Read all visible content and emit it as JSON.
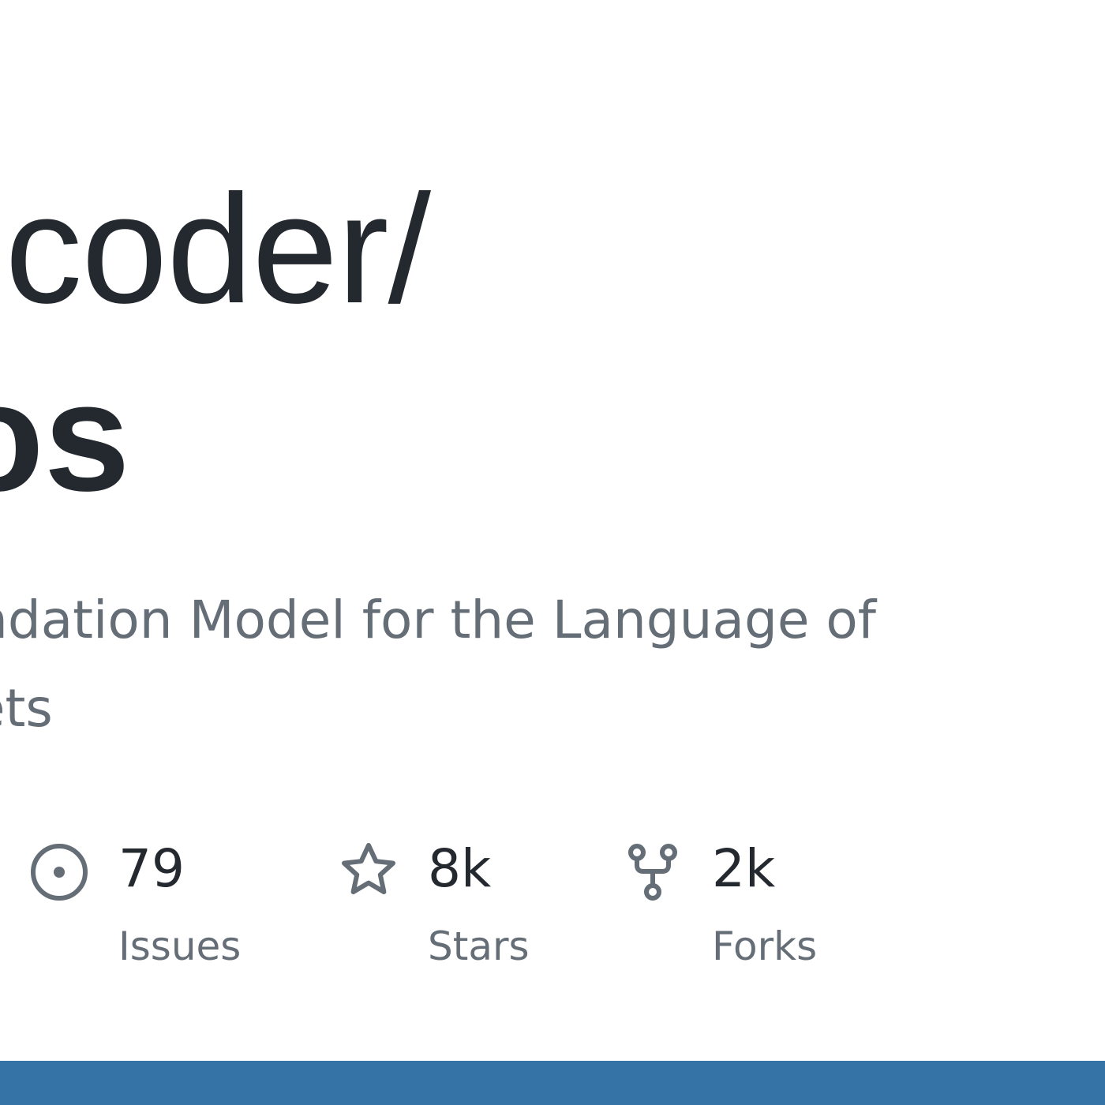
{
  "repo_card": {
    "owner_path": "-coder/",
    "repo_name": "os",
    "description_line1": "ndation Model for the Language of",
    "description_line2": "kets"
  },
  "stats": {
    "issues": {
      "count": "79",
      "label": "Issues",
      "icon": "issue-opened-icon"
    },
    "stars": {
      "count": "8k",
      "label": "Stars",
      "icon": "star-icon"
    },
    "forks": {
      "count": "2k",
      "label": "Forks",
      "icon": "repo-forked-icon"
    }
  },
  "colors": {
    "title": "#24292f",
    "muted": "#656d76",
    "icon": "#656d76",
    "bottom_bar": "#3572a5"
  }
}
